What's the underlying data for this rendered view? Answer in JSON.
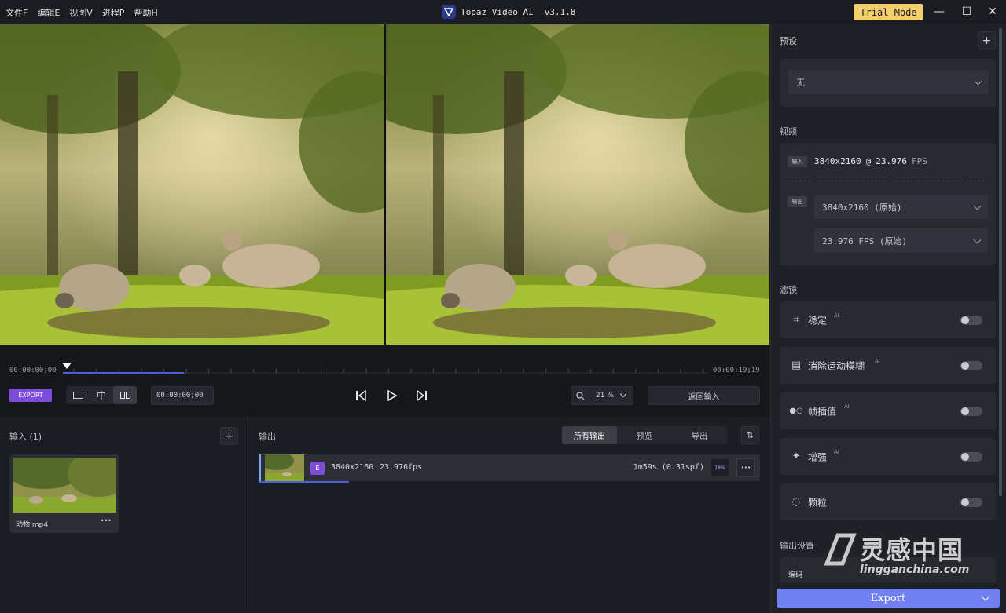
{
  "menu": [
    "文件F",
    "编辑E",
    "视图V",
    "进程P",
    "帮助H"
  ],
  "app": {
    "title": "Topaz Video AI",
    "version": "v3.1.8",
    "trial_label": "Trial Mode"
  },
  "window": {
    "minimize": "—",
    "maximize": "☐",
    "close": "✕"
  },
  "timeline": {
    "start_tc": "00:00:00;00",
    "end_tc": "00:00:19;19",
    "export_label": "EXPORT",
    "current_tc": "00:00:00;00",
    "zoom_value": "21 %",
    "return_label": "返回输入",
    "view_icon_middle": "中"
  },
  "inputs": {
    "title": "输入 (1)",
    "add": "+",
    "files": [
      {
        "name": "动物.mp4",
        "more": "•••"
      }
    ]
  },
  "outputs": {
    "title": "输出",
    "tabs": [
      "所有输出",
      "预览",
      "导出"
    ],
    "active_tab": 0,
    "sort_icon": "⇅",
    "items": [
      {
        "badge": "E",
        "resolution": "3840x2160",
        "fps": "23.976fps",
        "time": "1m59s (0.31spf)",
        "progress": "18%",
        "more": "•••",
        "progress_value": 0.18
      }
    ]
  },
  "sidebar": {
    "preset_label": "预设",
    "preset_add": "+",
    "preset_value": "无",
    "video_label": "视频",
    "input_tag": "输入",
    "input_res": "3840x2160",
    "input_at": "@",
    "input_fps": "23.976",
    "input_fps_unit": "FPS",
    "output_tag": "输出",
    "output_res": "3840x2160 (原始)",
    "output_fps": "23.976 FPS (原始)",
    "filters_label": "滤镜",
    "filters": [
      {
        "label": "稳定",
        "ai": "AI",
        "icon": "stabilize-icon",
        "glyph": "⌗"
      },
      {
        "label": "消除运动模糊",
        "ai": "AI",
        "icon": "motion-blur-icon",
        "glyph": "▤"
      },
      {
        "label": "帧插值",
        "ai": "AI",
        "icon": "frame-interpolation-icon",
        "glyph": "●○"
      },
      {
        "label": "增强",
        "ai": "AI",
        "icon": "enhance-icon",
        "glyph": "✦"
      },
      {
        "label": "颗粒",
        "ai": "",
        "icon": "grain-icon",
        "glyph": "◌"
      }
    ],
    "output_settings_label": "输出设置",
    "codec_label": "编码",
    "export_label": "Export"
  },
  "watermark": {
    "brand": "灵感中国",
    "url": "lingganchina.com"
  },
  "colors": {
    "accent": "#7c4ddb",
    "export_blue": "#7180f0",
    "trial": "#f2cf6b",
    "progress_blue": "#4c5fe0"
  }
}
